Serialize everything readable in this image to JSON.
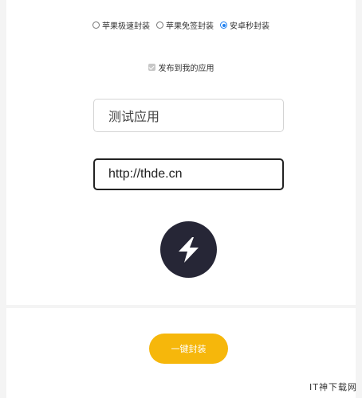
{
  "pack_options": [
    {
      "label": "苹果极速封装",
      "checked": false
    },
    {
      "label": "苹果免签封装",
      "checked": false
    },
    {
      "label": "安卓秒封装",
      "checked": true
    }
  ],
  "publish": {
    "label": "发布到我的应用",
    "checked": true
  },
  "app_name": {
    "value": "测试应用"
  },
  "app_url": {
    "value": "http://thde.cn"
  },
  "app_icon": {
    "name": "lightning-icon",
    "color": "#262636"
  },
  "submit": {
    "label": "一键封装",
    "color": "#f6b70b"
  },
  "watermark": {
    "text": "IT神下载网"
  }
}
